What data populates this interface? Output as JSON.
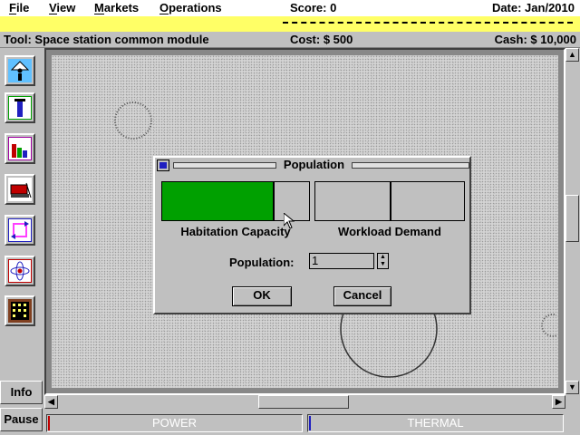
{
  "menu": {
    "file": "File",
    "view": "View",
    "markets": "Markets",
    "operations": "Operations"
  },
  "score": "Score: 0",
  "date": "Date: Jan/2010",
  "status": {
    "tool": "Tool: Space station common module",
    "cost": "Cost: $ 500",
    "cash": "Cash: $ 10,000"
  },
  "sidebar": {
    "info": "Info",
    "pause": "Pause",
    "tools": [
      "habitat-tool-icon",
      "column-tool-icon",
      "market-tool-icon",
      "cargo-tool-icon",
      "recycle-tool-icon",
      "atom-tool-icon",
      "building-tool-icon"
    ]
  },
  "meters": {
    "power": "POWER",
    "thermal": "THERMAL",
    "power_level": 0,
    "thermal_level": 0
  },
  "dialog": {
    "title": "Population",
    "habitation_label": "Habitation Capacity",
    "workload_label": "Workload Demand",
    "habitation_fill": 0.75,
    "workload_fill": 0.5,
    "population_label": "Population:",
    "population_value": "1",
    "ok": "OK",
    "cancel": "Cancel"
  },
  "colors": {
    "ticker_bg": "#ffff66",
    "capacity_fill": "#00a000",
    "highlight_blue": "#2020c0"
  }
}
